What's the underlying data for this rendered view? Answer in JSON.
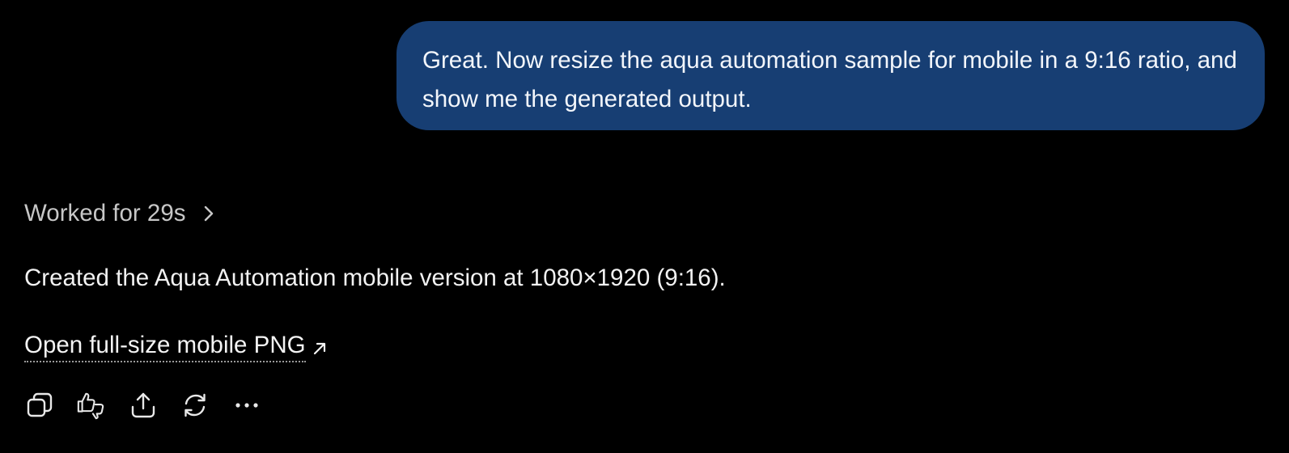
{
  "conversation": {
    "user_message": "Great. Now resize the aqua automation sample for mobile in a 9:16 ratio, and show me the generated output.",
    "assistant": {
      "worked_label": "Worked for 29s",
      "summary": "Created the Aqua Automation mobile version at 1080×1920 (9:16).",
      "link_text": "Open full-size mobile PNG"
    }
  },
  "actions": [
    {
      "name": "copy",
      "icon": "copy-icon"
    },
    {
      "name": "feedback",
      "icon": "thumbs-up-down-icon"
    },
    {
      "name": "share",
      "icon": "share-icon"
    },
    {
      "name": "regenerate",
      "icon": "regenerate-icon"
    },
    {
      "name": "more",
      "icon": "more-icon"
    }
  ],
  "colors": {
    "background": "#000000",
    "user_bubble": "#173e73",
    "text_primary": "#f2f2f2",
    "text_muted": "#c7c7c7"
  }
}
